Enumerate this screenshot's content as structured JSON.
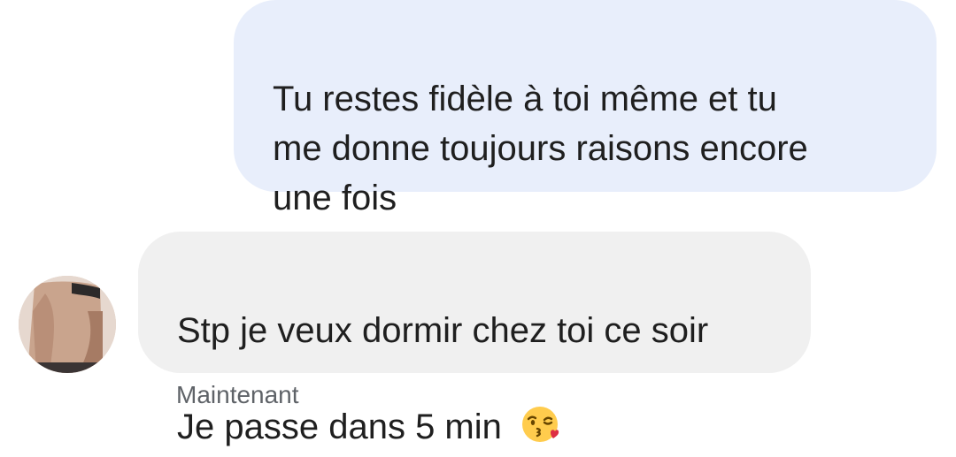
{
  "conversation": {
    "messages": [
      {
        "direction": "outgoing",
        "text": "Tu restes fidèle à toi même et tu\nme donne toujours raisons encore\nune fois"
      },
      {
        "direction": "incoming",
        "text": "Stp je veux dormir chez toi ce soir\nJe passe dans 5 min ",
        "emoji": "kissing-face-with-heart-emoji"
      }
    ],
    "timestamp": "Maintenant"
  },
  "colors": {
    "outgoing_bubble": "#e8eefb",
    "incoming_bubble": "#f0f0f0",
    "text": "#1f1f1f",
    "timestamp": "#5f6368"
  }
}
